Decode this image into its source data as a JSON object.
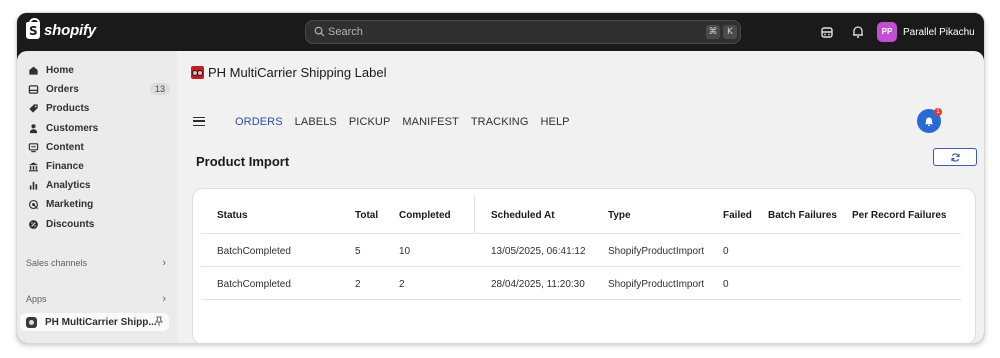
{
  "topbar": {
    "logo_text": "shopify",
    "logo_glyph": "S",
    "search_placeholder": "Search",
    "shortcut_keys": [
      "⌘",
      "K"
    ],
    "user_initials": "PP",
    "user_name": "Parallel Pikachu",
    "avatar_color": "#c04fd2"
  },
  "sidebar": {
    "items": [
      {
        "label": "Home",
        "icon": "home-icon"
      },
      {
        "label": "Orders",
        "icon": "inbox-icon",
        "badge": "13"
      },
      {
        "label": "Products",
        "icon": "tag-icon"
      },
      {
        "label": "Customers",
        "icon": "person-icon"
      },
      {
        "label": "Content",
        "icon": "content-icon"
      },
      {
        "label": "Finance",
        "icon": "bank-icon"
      },
      {
        "label": "Analytics",
        "icon": "bar-chart-icon"
      },
      {
        "label": "Marketing",
        "icon": "target-icon"
      },
      {
        "label": "Discounts",
        "icon": "discount-icon"
      }
    ],
    "sales_channels_label": "Sales channels",
    "apps_label": "Apps",
    "chevron": "›",
    "app_item_label": "PH MultiCarrier Shipp..."
  },
  "main": {
    "app_title": "PH MultiCarrier Shipping Label",
    "tabs": [
      "ORDERS",
      "LABELS",
      "PICKUP",
      "MANIFEST",
      "TRACKING",
      "HELP"
    ],
    "active_tab": "ORDERS",
    "notification_count": "1",
    "page_title": "Product Import",
    "accent_color": "#2c4ea8",
    "table": {
      "headers": [
        "Status",
        "Total",
        "Completed",
        "Scheduled At",
        "Type",
        "Failed",
        "Batch Failures",
        "Per Record Failures"
      ],
      "rows": [
        [
          "BatchCompleted",
          "5",
          "10",
          "13/05/2025, 06:41:12",
          "ShopifyProductImport",
          "0",
          "",
          ""
        ],
        [
          "BatchCompleted",
          "2",
          "2",
          "28/04/2025, 11:20:30",
          "ShopifyProductImport",
          "0",
          "",
          ""
        ]
      ]
    }
  }
}
